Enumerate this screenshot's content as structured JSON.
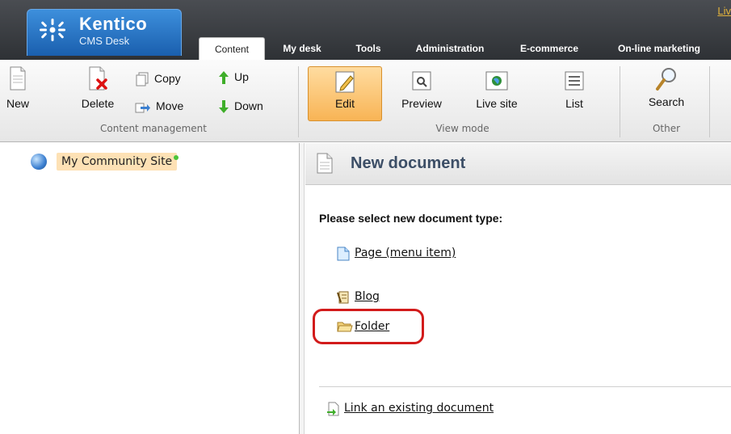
{
  "app": {
    "logo_title": "Kentico",
    "logo_subtitle": "CMS Desk",
    "live_link": "Liv"
  },
  "tabs": [
    {
      "label": "Content",
      "active": true
    },
    {
      "label": "My desk"
    },
    {
      "label": "Tools"
    },
    {
      "label": "Administration"
    },
    {
      "label": "E-commerce"
    },
    {
      "label": "On-line marketing"
    }
  ],
  "toolbar": {
    "new": "New",
    "delete": "Delete",
    "copy": "Copy",
    "move": "Move",
    "up": "Up",
    "down": "Down",
    "edit": "Edit",
    "preview": "Preview",
    "live_site": "Live site",
    "list": "List",
    "search": "Search",
    "groups": {
      "content_management": "Content management",
      "view_mode": "View mode",
      "other": "Other"
    }
  },
  "tree": {
    "root": "My Community Site"
  },
  "panel": {
    "title": "New document",
    "prompt": "Please select new document type:",
    "doc_types": [
      "Page (menu item)",
      "Blog",
      "Folder"
    ],
    "link_existing": "Link an existing document"
  },
  "colors": {
    "header_dark": "#3b3e42",
    "logo_blue": "#2a74c4",
    "active_button": "#f8b455",
    "tree_selected": "#fde1b5",
    "highlight_ring": "#d21b1b",
    "panel_title": "#3c4e66"
  }
}
